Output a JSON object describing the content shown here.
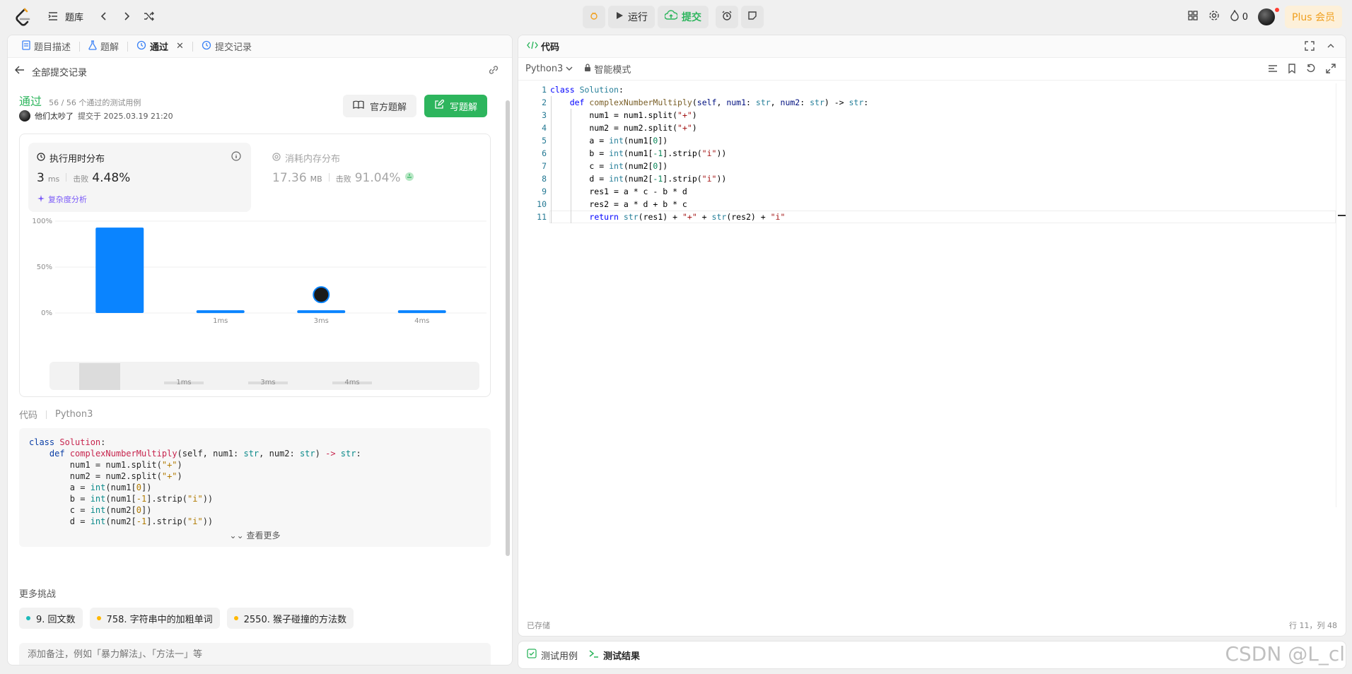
{
  "topbar": {
    "problem_bank": "题库",
    "run": "运行",
    "submit": "提交",
    "flame_count": "0",
    "plus": "Plus 会员"
  },
  "left_tabs": [
    {
      "label": "题目描述"
    },
    {
      "label": "题解"
    },
    {
      "label": "通过"
    },
    {
      "label": "提交记录"
    }
  ],
  "back": {
    "label": "全部提交记录"
  },
  "submission": {
    "status": "通过",
    "passed": "56 / 56 个通过的测试用例",
    "user": "他们太吵了",
    "submitted_at": "提交于 2025.03.19 21:20",
    "official_solution": "官方题解",
    "write_solution": "写题解"
  },
  "runtime": {
    "title": "执行用时分布",
    "value": "3",
    "unit": "ms",
    "beat_label": "击败",
    "beat": "4.48%",
    "analysis": "复杂度分析"
  },
  "memory": {
    "title": "消耗内存分布",
    "value": "17.36",
    "unit": "MB",
    "beat_label": "击败",
    "beat": "91.04%"
  },
  "chart_data": {
    "type": "bar",
    "categories": [
      "",
      "1ms",
      "3ms",
      "4ms"
    ],
    "values": [
      93,
      3,
      3,
      3
    ],
    "yticks": [
      "100%",
      "50%",
      "0%"
    ],
    "ylim": [
      0,
      100
    ],
    "highlight": "3ms",
    "mini_labels": [
      "1ms",
      "3ms",
      "4ms"
    ],
    "bar_color": "#0a84ff"
  },
  "code_panel": {
    "label": "代码",
    "language": "Python3",
    "more": "查看更多",
    "lines": [
      "class Solution:",
      "    def complexNumberMultiply(self, num1: str, num2: str) -> str:",
      "        num1 = num1.split(\"+\")",
      "        num2 = num2.split(\"+\")",
      "        a = int(num1[0])",
      "        b = int(num1[-1].strip(\"i\"))",
      "        c = int(num2[0])",
      "        d = int(num2[-1].strip(\"i\"))"
    ]
  },
  "challenges": {
    "title": "更多挑战",
    "items": [
      {
        "label": "9. 回文数",
        "color": "#1cbaba"
      },
      {
        "label": "758. 字符串中的加粗单词",
        "color": "#ffb800"
      },
      {
        "label": "2550. 猴子碰撞的方法数",
        "color": "#ffb800"
      }
    ]
  },
  "note": {
    "placeholder": "添加备注，例如「暴力解法」、「方法一」等"
  },
  "editor": {
    "tab": "代码",
    "language": "Python3",
    "mode": "智能模式",
    "saved": "已存储",
    "position": "行 11，列 48",
    "lines": [
      "class Solution:",
      "    def complexNumberMultiply(self, num1: str, num2: str) -> str:",
      "        num1 = num1.split(\"+\")",
      "        num2 = num2.split(\"+\")",
      "        a = int(num1[0])",
      "        b = int(num1[-1].strip(\"i\"))",
      "        c = int(num2[0])",
      "        d = int(num2[-1].strip(\"i\"))",
      "        res1 = a * c - b * d",
      "        res2 = a * d + b * c",
      "        return str(res1) + \"+\" + str(res2) + \"i\""
    ]
  },
  "bottom_tabs": [
    {
      "label": "测试用例"
    },
    {
      "label": "测试结果"
    }
  ],
  "watermark": "CSDN @L_cl"
}
